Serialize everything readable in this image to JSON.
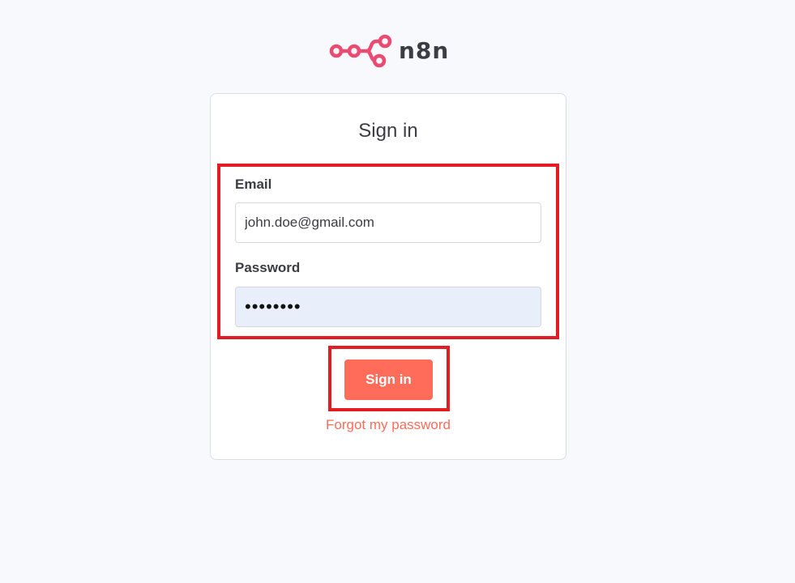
{
  "brand": {
    "name": "n8n",
    "logo_icon": "n8n-logo-icon",
    "logo_color": "#ea4b71"
  },
  "form": {
    "title": "Sign in",
    "email": {
      "label": "Email",
      "value": "john.doe@gmail.com"
    },
    "password": {
      "label": "Password",
      "value": "••••••••"
    },
    "submit_label": "Sign in",
    "forgot_link": "Forgot my password"
  },
  "colors": {
    "accent": "#ff6d5a",
    "highlight": "#e31c23",
    "autofill_bg": "#e8effb"
  }
}
